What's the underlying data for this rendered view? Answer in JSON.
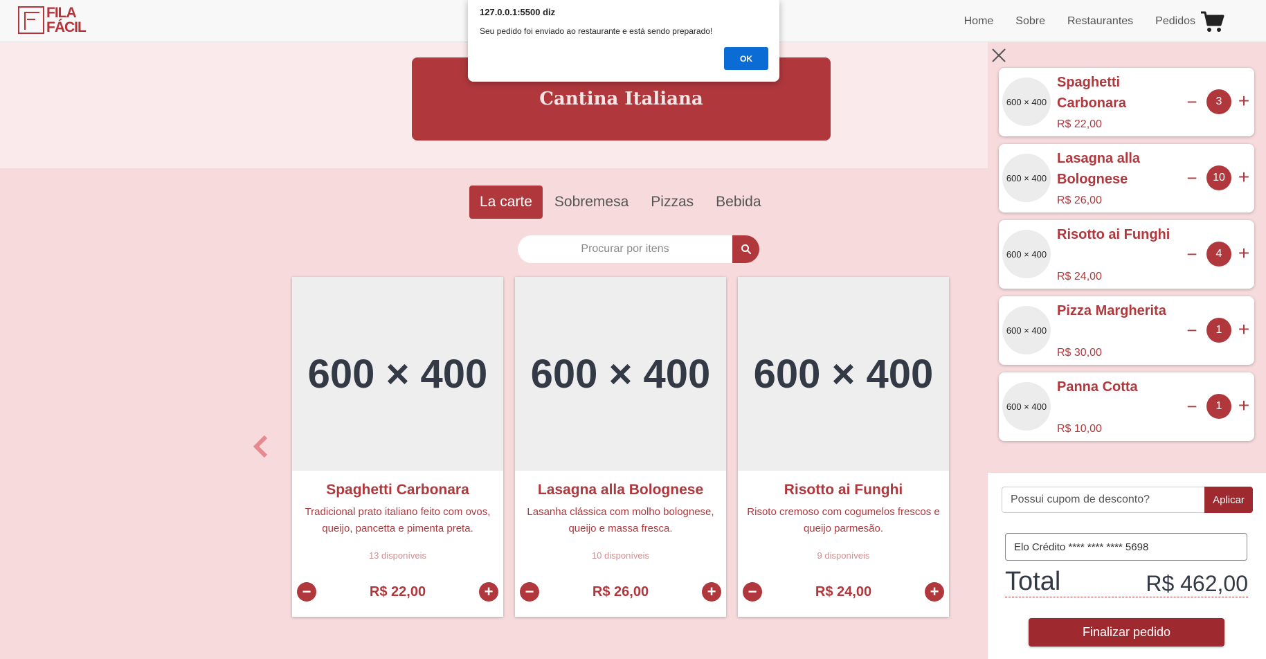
{
  "brand": {
    "line1": "FILA",
    "line2": "FÁCIL"
  },
  "nav": {
    "home": "Home",
    "about": "Sobre",
    "restaurants": "Restaurantes",
    "orders": "Pedidos"
  },
  "hero": {
    "title": "Cantina Italiana"
  },
  "tabs": [
    {
      "label": "La carte",
      "active": true
    },
    {
      "label": "Sobremesa"
    },
    {
      "label": "Pizzas"
    },
    {
      "label": "Bebida"
    }
  ],
  "search": {
    "placeholder": "Procurar por itens"
  },
  "products": [
    {
      "image": "600 × 400",
      "name": "Spaghetti Carbonara",
      "desc": "Tradicional prato italiano feito com ovos, queijo, pancetta e pimenta preta.",
      "stock": "13 disponíveis",
      "price": "R$ 22,00"
    },
    {
      "image": "600 × 400",
      "name": "Lasagna alla Bolognese",
      "desc": "Lasanha clássica com molho bolognese, queijo e massa fresca.",
      "stock": "10 disponíveis",
      "price": "R$ 26,00"
    },
    {
      "image": "600 × 400",
      "name": "Risotto ai Funghi",
      "desc": "Risoto cremoso com cogumelos frescos e queijo parmesão.",
      "stock": "9 disponíveis",
      "price": "R$ 24,00"
    }
  ],
  "cart": {
    "items": [
      {
        "thumb": "600 × 400",
        "name": "Spaghetti Carbonara",
        "price": "R$ 22,00",
        "qty": "3"
      },
      {
        "thumb": "600 × 400",
        "name": "Lasagna alla Bolognese",
        "price": "R$ 26,00",
        "qty": "10"
      },
      {
        "thumb": "600 × 400",
        "name": "Risotto ai Funghi",
        "price": "R$ 24,00",
        "qty": "4"
      },
      {
        "thumb": "600 × 400",
        "name": "Pizza Margherita",
        "price": "R$ 30,00",
        "qty": "1"
      },
      {
        "thumb": "600 × 400",
        "name": "Panna Cotta",
        "price": "R$ 10,00",
        "qty": "1"
      }
    ],
    "coupon_placeholder": "Possui cupom de desconto?",
    "coupon_button": "Aplicar",
    "payment": "Elo Crédito **** **** **** 5698",
    "total_label": "Total",
    "total_value": "R$ 462,00",
    "checkout": "Finalizar pedido"
  },
  "alert": {
    "title": "127.0.0.1:5500 diz",
    "message": "Seu pedido foi enviado ao restaurante e está sendo preparado!",
    "ok": "OK"
  },
  "colors": {
    "primary": "#b0383d",
    "dark_primary": "#9e2a2f",
    "page_bg": "#f6dadc",
    "hero_bg": "#fbeaeb",
    "alert_button": "#0b6cd6"
  },
  "icons": {
    "cart": "shopping-cart-icon",
    "search": "search-icon",
    "close": "close-icon",
    "prev": "chevron-left-icon"
  }
}
